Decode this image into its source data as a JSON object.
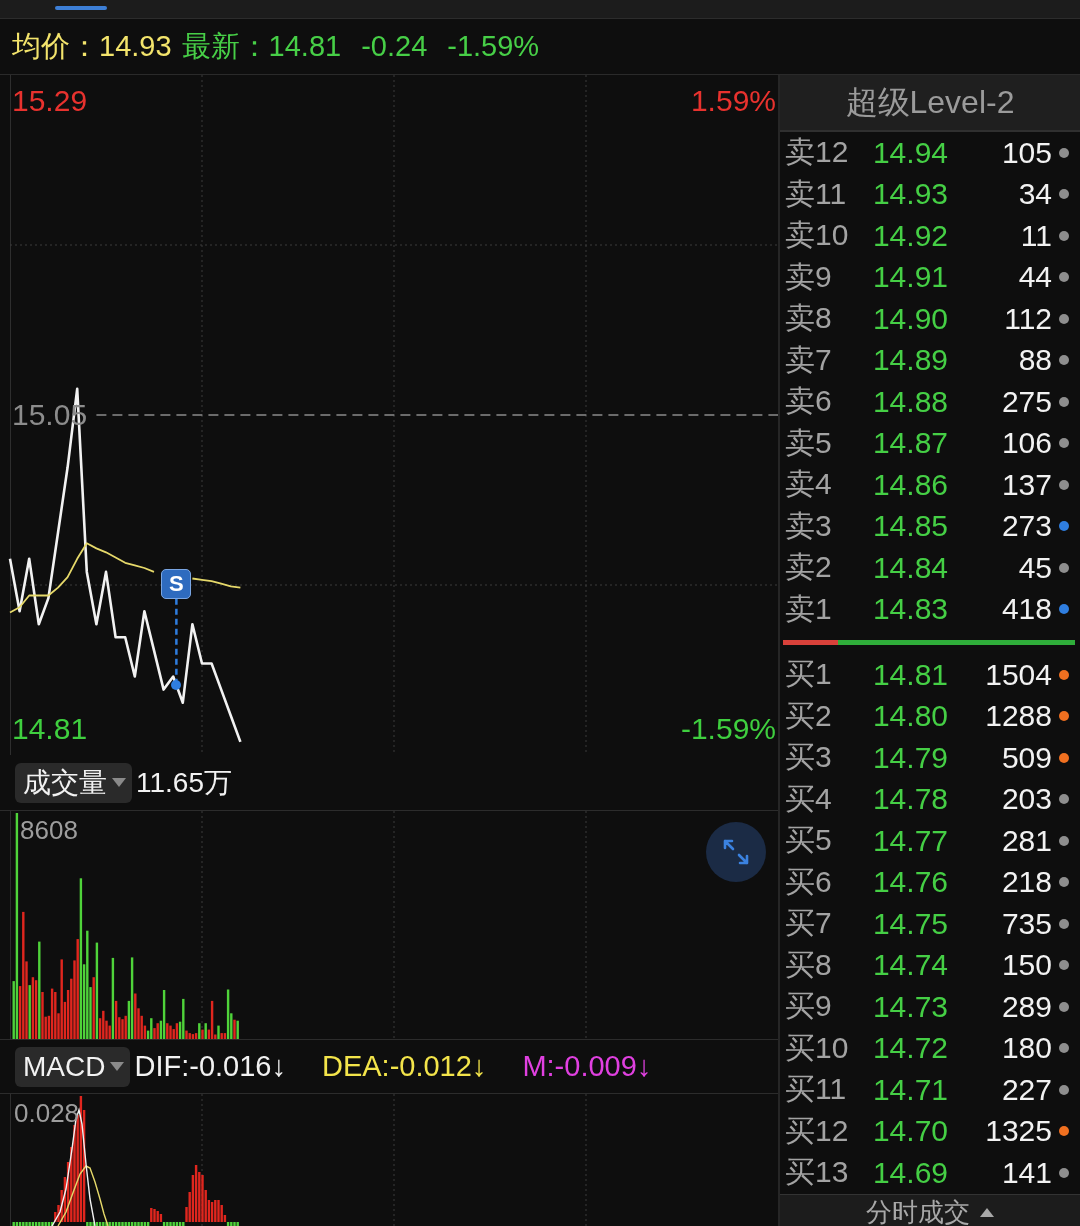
{
  "quote_bar": {
    "average_label": "均价：",
    "average_value": "14.93",
    "latest_label": "最新：",
    "latest_value": "14.81",
    "change": "-0.24",
    "change_percent": "-1.59%"
  },
  "price_chart": {
    "right_labels": [
      "1.59%",
      "-1.59%"
    ],
    "signal": {
      "label": "S"
    },
    "chart_data": {
      "type": "line",
      "grid": true,
      "categories": [
        null,
        null,
        null,
        null,
        null,
        null,
        null,
        null,
        null,
        null,
        null,
        null,
        null,
        null,
        null,
        null,
        null,
        null,
        null,
        null,
        null,
        null,
        null,
        null,
        null,
        null,
        null,
        null,
        null,
        null,
        null,
        null,
        null,
        null,
        null,
        null,
        null,
        null,
        null,
        null,
        null,
        null,
        null,
        null,
        null,
        null,
        null,
        null,
        null,
        null,
        null,
        null,
        null,
        null,
        null,
        null,
        null,
        null,
        null,
        null,
        null,
        null,
        null,
        null,
        null,
        null,
        null,
        null,
        null,
        null,
        null,
        null,
        null,
        null,
        null,
        null,
        null,
        null,
        null,
        null,
        null
      ],
      "series": [
        {
          "color": "#f2f2f2",
          "values": [
            14.94,
            14.9,
            14.94,
            14.89,
            14.91,
            14.96,
            15.01,
            15.07,
            14.93,
            14.89,
            14.93,
            14.88,
            14.88,
            14.85,
            14.9,
            14.87,
            14.84,
            14.85,
            14.83,
            14.89,
            14.86,
            14.86,
            14.84,
            14.82,
            14.8,
            null,
            null,
            null,
            null,
            null,
            null,
            null,
            null,
            null,
            null,
            null,
            null,
            null,
            null,
            null,
            null,
            null,
            null,
            null,
            null,
            null,
            null,
            null,
            null,
            null,
            null,
            null,
            null,
            null,
            null,
            null,
            null,
            null,
            null,
            null,
            null,
            null,
            null,
            null,
            null,
            null,
            null,
            null,
            null,
            null,
            null,
            null,
            null,
            null,
            null,
            null,
            null,
            null,
            null,
            null,
            null
          ]
        },
        {
          "color": "#e6d96a",
          "values": [
            14.899,
            14.903,
            14.912,
            14.912,
            14.912,
            14.918,
            14.926,
            14.94,
            14.952,
            14.948,
            14.945,
            14.941,
            14.937,
            14.935,
            14.933,
            14.93,
            null,
            null,
            null,
            14.925,
            14.924,
            14.923,
            14.921,
            14.919,
            14.918,
            null,
            null,
            null,
            null,
            null,
            null,
            null,
            null,
            null,
            null,
            null,
            null,
            null,
            null,
            null,
            null,
            null,
            null,
            null,
            null,
            null,
            null,
            null,
            null,
            null,
            null,
            null,
            null,
            null,
            null,
            null,
            null,
            null,
            null,
            null,
            null,
            null,
            null,
            null,
            null,
            null,
            null,
            null,
            null,
            null,
            null,
            null,
            null,
            null,
            null,
            null,
            null,
            null,
            null,
            null,
            null
          ]
        },
        {
          "color": "#8a8a8a",
          "line_style": "dashed",
          "values": [
            null,
            null,
            null,
            null,
            null,
            null,
            null,
            null,
            null,
            15.05,
            15.05,
            15.05,
            15.05,
            15.05,
            15.05,
            15.05,
            15.05,
            15.05,
            15.05,
            15.05,
            15.05,
            15.05,
            15.05,
            15.05,
            15.05,
            15.05,
            15.05,
            15.05,
            15.05,
            15.05,
            15.05,
            15.05,
            15.05,
            15.05,
            15.05,
            15.05,
            15.05,
            15.05,
            15.05,
            15.05,
            15.05,
            15.05,
            15.05,
            15.05,
            15.05,
            15.05,
            15.05,
            15.05,
            15.05,
            15.05,
            15.05,
            15.05,
            15.05,
            15.05,
            15.05,
            15.05,
            15.05,
            15.05,
            15.05,
            15.05,
            15.05,
            15.05,
            15.05,
            15.05,
            15.05,
            15.05,
            15.05,
            15.05,
            15.05,
            15.05,
            15.05,
            15.05,
            15.05,
            15.05,
            15.05,
            15.05,
            15.05,
            15.05,
            15.05,
            15.05,
            15.05
          ]
        }
      ],
      "ylim": [
        14.79,
        15.31
      ],
      "yticks": [
        {
          "value": 15.29,
          "label": "15.29"
        },
        {
          "value": 15.05,
          "label": "15.05"
        },
        {
          "value": 14.81,
          "label": "14.81"
        }
      ]
    }
  },
  "volume_panel": {
    "selector": "成交量",
    "total": "11.65万",
    "max_label": "8608"
  },
  "macd_panel": {
    "selector": "MACD",
    "indicators": [
      {
        "text": "DIF:-0.016↓",
        "color": "#f2f2f2"
      },
      {
        "text": "DEA:-0.012↓",
        "color": "#f3e44a"
      },
      {
        "text": "M:-0.009↓",
        "color": "#e040e0"
      }
    ],
    "max_label": "0.028"
  },
  "order_book": {
    "title": "超级Level-2",
    "asks": [
      {
        "label": "卖12",
        "price": "14.94",
        "volume": "105",
        "color": "#8e8e8e"
      },
      {
        "label": "卖11",
        "price": "14.93",
        "volume": "34",
        "color": "#8e8e8e"
      },
      {
        "label": "卖10",
        "price": "14.92",
        "volume": "11",
        "color": "#8e8e8e"
      },
      {
        "label": "卖9",
        "price": "14.91",
        "volume": "44",
        "color": "#8e8e8e"
      },
      {
        "label": "卖8",
        "price": "14.90",
        "volume": "112",
        "color": "#8e8e8e"
      },
      {
        "label": "卖7",
        "price": "14.89",
        "volume": "88",
        "color": "#8e8e8e"
      },
      {
        "label": "卖6",
        "price": "14.88",
        "volume": "275",
        "color": "#8e8e8e"
      },
      {
        "label": "卖5",
        "price": "14.87",
        "volume": "106",
        "color": "#8e8e8e"
      },
      {
        "label": "卖4",
        "price": "14.86",
        "volume": "137",
        "color": "#8e8e8e"
      },
      {
        "label": "卖3",
        "price": "14.85",
        "volume": "273",
        "color": "#2f7ee0"
      },
      {
        "label": "卖2",
        "price": "14.84",
        "volume": "45",
        "color": "#8e8e8e"
      },
      {
        "label": "卖1",
        "price": "14.83",
        "volume": "418",
        "color": "#2f7ee0"
      }
    ],
    "ratio_bar": {
      "level": 0.19
    },
    "bids": [
      {
        "label": "买1",
        "price": "14.81",
        "volume": "1504",
        "color": "#f07020"
      },
      {
        "label": "买2",
        "price": "14.80",
        "volume": "1288",
        "color": "#f07020"
      },
      {
        "label": "买3",
        "price": "14.79",
        "volume": "509",
        "color": "#f07020"
      },
      {
        "label": "买4",
        "price": "14.78",
        "volume": "203",
        "color": "#8e8e8e"
      },
      {
        "label": "买5",
        "price": "14.77",
        "volume": "281",
        "color": "#8e8e8e"
      },
      {
        "label": "买6",
        "price": "14.76",
        "volume": "218",
        "color": "#8e8e8e"
      },
      {
        "label": "买7",
        "price": "14.75",
        "volume": "735",
        "color": "#8e8e8e"
      },
      {
        "label": "买8",
        "price": "14.74",
        "volume": "150",
        "color": "#8e8e8e"
      },
      {
        "label": "买9",
        "price": "14.73",
        "volume": "289",
        "color": "#8e8e8e"
      },
      {
        "label": "买10",
        "price": "14.72",
        "volume": "180",
        "color": "#8e8e8e"
      },
      {
        "label": "买11",
        "price": "14.71",
        "volume": "227",
        "color": "#8e8e8e"
      },
      {
        "label": "买12",
        "price": "14.70",
        "volume": "1325",
        "color": "#f07020"
      },
      {
        "label": "买13",
        "price": "14.69",
        "volume": "141",
        "color": "#8e8e8e"
      }
    ],
    "footer": "分时成交"
  }
}
